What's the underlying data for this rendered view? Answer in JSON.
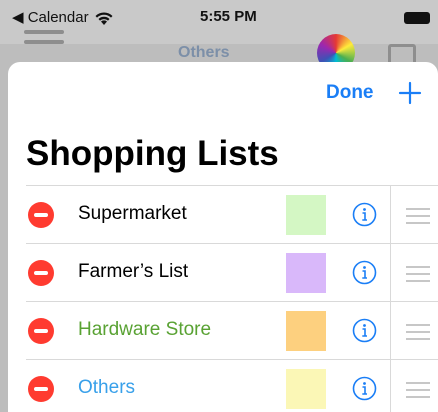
{
  "status_bar": {
    "back_label": "◀ Calendar",
    "time": "5:55 PM"
  },
  "background": {
    "title": "Others"
  },
  "nav": {
    "done_label": "Done"
  },
  "page_title": "Shopping Lists",
  "lists": [
    {
      "name": "Supermarket",
      "name_color": "#000000",
      "swatch_color": "#d4f7c4"
    },
    {
      "name": "Farmer’s List",
      "name_color": "#000000",
      "swatch_color": "#d9b8fa"
    },
    {
      "name": "Hardware Store",
      "name_color": "#59a233",
      "swatch_color": "#fdd07f"
    },
    {
      "name": "Others",
      "name_color": "#38a0ea",
      "swatch_color": "#fbf7b6"
    }
  ],
  "colors": {
    "accent": "#1a7ef6",
    "delete": "#ff3b30"
  }
}
